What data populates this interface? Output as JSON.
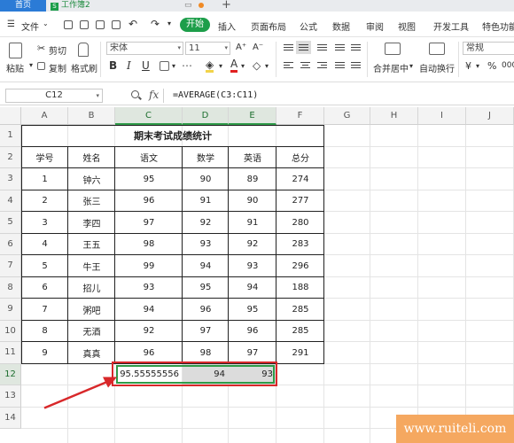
{
  "tabs": {
    "home": "首页",
    "doc_icon": "S",
    "doc": "工作簿2",
    "controls": [
      "▭",
      "•",
      "+"
    ]
  },
  "menu": {
    "file": "文件",
    "file_arrow": "⌄",
    "start": "开始",
    "items": [
      "插入",
      "页面布局",
      "公式",
      "数据",
      "审阅",
      "视图",
      "开发工具",
      "特色功能"
    ]
  },
  "ribbon": {
    "paste": "粘贴",
    "cut": "剪切",
    "copy": "复制",
    "format_painter": "格式刷",
    "font_name": "宋体",
    "font_size": "11",
    "grow": "A⁺",
    "shrink": "A⁻",
    "bold": "B",
    "italic": "I",
    "underline": "U",
    "merge_center": "合并居中",
    "wrap": "自动换行",
    "number_format": "常规",
    "currency": "¥",
    "percent": "%",
    "thousands": "000"
  },
  "formula_bar": {
    "cell_ref": "C12",
    "fx": "fx",
    "formula": "=AVERAGE(C3:C11)"
  },
  "grid": {
    "columns": [
      "A",
      "B",
      "C",
      "D",
      "E",
      "F",
      "G",
      "H",
      "I",
      "J"
    ],
    "rows": [
      "1",
      "2",
      "3",
      "4",
      "5",
      "6",
      "7",
      "8",
      "9",
      "10",
      "11",
      "12",
      "13",
      "14"
    ],
    "title": "期末考试成绩统计",
    "headers": [
      "学号",
      "姓名",
      "语文",
      "数学",
      "英语",
      "总分"
    ],
    "data": [
      [
        "1",
        "钟六",
        "95",
        "90",
        "89",
        "274"
      ],
      [
        "2",
        "张三",
        "96",
        "91",
        "90",
        "277"
      ],
      [
        "3",
        "李四",
        "97",
        "92",
        "91",
        "280"
      ],
      [
        "4",
        "王五",
        "98",
        "93",
        "92",
        "283"
      ],
      [
        "5",
        "牛王",
        "99",
        "94",
        "93",
        "296"
      ],
      [
        "6",
        "招儿",
        "93",
        "95",
        "94",
        "188"
      ],
      [
        "7",
        "粥吧",
        "94",
        "96",
        "95",
        "285"
      ],
      [
        "8",
        "无酒",
        "92",
        "97",
        "96",
        "285"
      ],
      [
        "9",
        "真真",
        "96",
        "98",
        "97",
        "291"
      ]
    ],
    "averages": [
      "95.55555556",
      "94",
      "93"
    ]
  },
  "watermark": "www.ruiteli.com",
  "colors": {
    "accent_green": "#1d9e4a",
    "highlight_red": "#d8282a",
    "watermark_orange": "#f5a860"
  }
}
